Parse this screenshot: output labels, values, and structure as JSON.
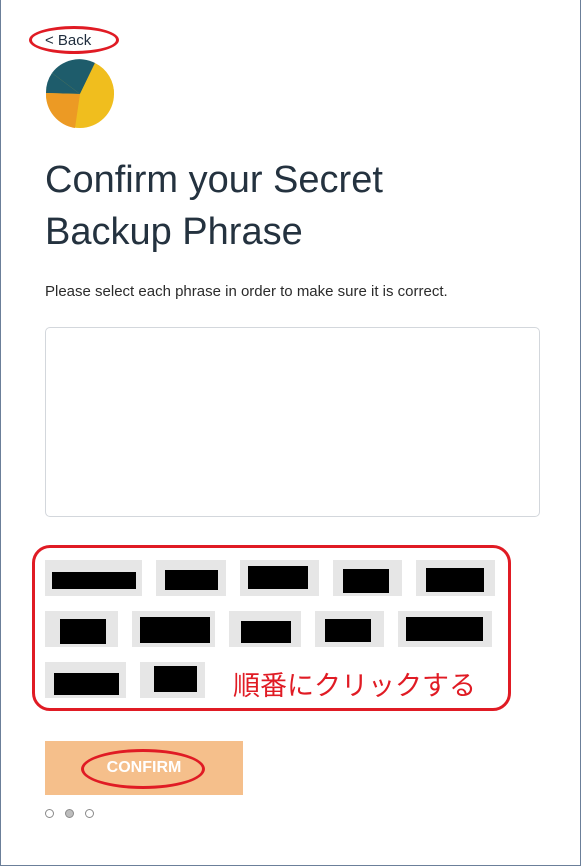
{
  "nav": {
    "back_label": "< Back"
  },
  "logo": {
    "icon": "fox-logo-icon"
  },
  "heading": {
    "title": "Confirm your Secret Backup Phrase",
    "instruction": "Please select each phrase in order to make sure it is correct."
  },
  "word_chips": [
    {
      "state": "redacted"
    },
    {
      "state": "redacted"
    },
    {
      "state": "redacted"
    },
    {
      "state": "redacted"
    },
    {
      "state": "redacted"
    },
    {
      "state": "redacted"
    },
    {
      "state": "redacted"
    },
    {
      "state": "redacted"
    },
    {
      "state": "redacted"
    },
    {
      "state": "redacted"
    },
    {
      "state": "redacted"
    },
    {
      "state": "redacted"
    }
  ],
  "annotation": {
    "text": "順番にクリックする"
  },
  "actions": {
    "confirm_label": "CONFIRM"
  },
  "pager": {
    "total": 3,
    "current": 2
  },
  "colors": {
    "annotation_red": "#e01b24",
    "confirm_bg": "#f5bf8b",
    "chip_bg": "#e6e6e6",
    "title_text": "#24323f"
  }
}
